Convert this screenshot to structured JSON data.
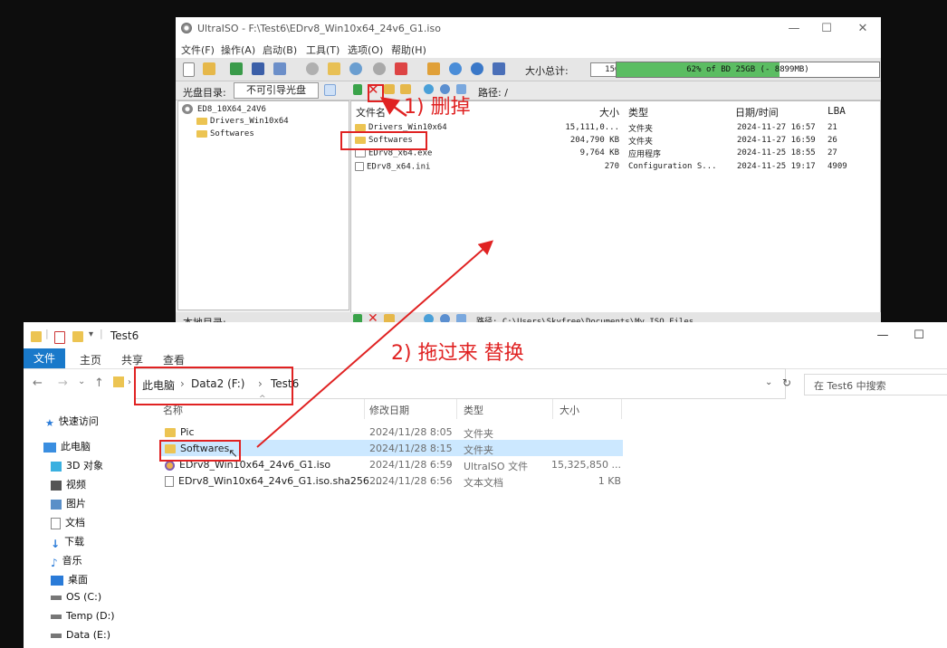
{
  "ultraiso": {
    "title": "UltraISO - F:\\Test6\\EDrv8_Win10x64_24v6_G1.iso",
    "menu": [
      "文件(F)",
      "操作(A)",
      "启动(B)",
      "工具(T)",
      "选项(O)",
      "帮助(H)"
    ],
    "size_label": "大小总计:",
    "size_value": "15GB",
    "capacity_text": "62% of BD 25GB (- 8899MB)",
    "capacity_percent": 62,
    "disc_dir_label": "光盘目录:",
    "boot_type": "不可引导光盘",
    "path_label": "路径: /",
    "tree": [
      "ED8_10X64_24V6",
      "Drivers_Win10x64",
      "Softwares"
    ],
    "columns": [
      "文件名",
      "大小",
      "类型",
      "日期/时间",
      "LBA"
    ],
    "files": [
      {
        "name": "Drivers_Win10x64",
        "size": "15,111,0...",
        "type": "文件夹",
        "date": "2024-11-27 16:57",
        "lba": "21"
      },
      {
        "name": "Softwares",
        "size": "204,790 KB",
        "type": "文件夹",
        "date": "2024-11-27 16:59",
        "lba": "26"
      },
      {
        "name": "EDrv8_x64.exe",
        "size": "9,764 KB",
        "type": "应用程序",
        "date": "2024-11-25 18:55",
        "lba": "27"
      },
      {
        "name": "EDrv8_x64.ini",
        "size": "270",
        "type": "Configuration S...",
        "date": "2024-11-25 19:17",
        "lba": "4909"
      }
    ],
    "local_dir_label": "本地目录:",
    "local_path": "路径: C:\\Users\\Skyfree\\Documents\\My ISO Files"
  },
  "explorer": {
    "title": "Test6",
    "ribbon_tabs": [
      "文件",
      "主页",
      "共享",
      "查看"
    ],
    "breadcrumb": [
      "此电脑",
      "Data2 (F:)",
      "Test6"
    ],
    "search_placeholder": "在 Test6 中搜索",
    "sidebar": [
      "快速访问",
      "此电脑",
      "3D 对象",
      "视频",
      "图片",
      "文档",
      "下载",
      "音乐",
      "桌面",
      "OS (C:)",
      "Temp (D:)",
      "Data (E:)"
    ],
    "columns": [
      "名称",
      "修改日期",
      "类型",
      "大小"
    ],
    "files": [
      {
        "name": "Pic",
        "date": "2024/11/28 8:05",
        "type": "文件夹",
        "size": ""
      },
      {
        "name": "Softwares",
        "date": "2024/11/28 8:15",
        "type": "文件夹",
        "size": ""
      },
      {
        "name": "EDrv8_Win10x64_24v6_G1.iso",
        "date": "2024/11/28 6:59",
        "type": "UltraISO 文件",
        "size": "15,325,850 ..."
      },
      {
        "name": "EDrv8_Win10x64_24v6_G1.iso.sha256....",
        "date": "2024/11/28 6:56",
        "type": "文本文档",
        "size": "1 KB"
      }
    ]
  },
  "annotations": {
    "step1": "1) 删掉",
    "step2": "2) 拖过来 替换"
  },
  "colors": {
    "annotation": "#e02222",
    "selection": "#cce8ff",
    "ribbon_file": "#1979ca",
    "capacity": "#5bbd62"
  }
}
